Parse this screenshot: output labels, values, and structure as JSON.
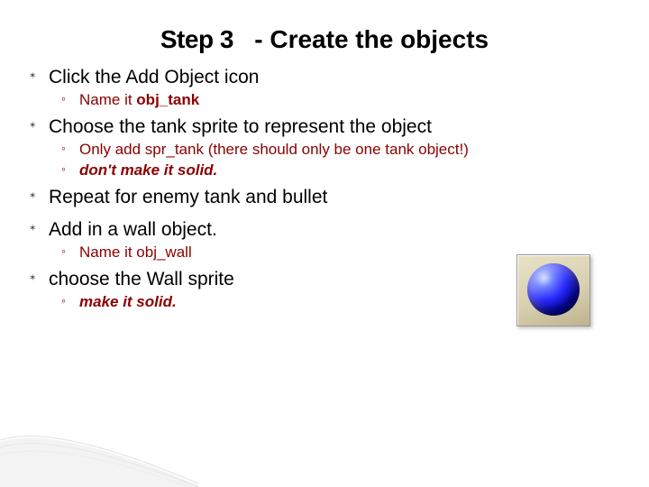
{
  "title_a": "Step 3",
  "title_b": "- Create the objects",
  "items": [
    {
      "text": "Click the Add Object icon",
      "subs": [
        {
          "pre": "Name it ",
          "bold": "obj_tank",
          "post": ""
        }
      ]
    },
    {
      "text": "Choose the tank sprite to represent the object",
      "subs": [
        {
          "pre": "Only add spr_tank (there should only be one tank object!)",
          "bold": "",
          "post": ""
        },
        {
          "pre": "",
          "boldItalic": "don't make it solid.",
          "post": ""
        }
      ]
    },
    {
      "text": "Repeat for enemy tank and bullet",
      "subs": []
    },
    {
      "text": "Add in a wall object.",
      "subs": [
        {
          "pre": " Name it obj_wall",
          "bold": "",
          "post": ""
        }
      ]
    },
    {
      "text": "choose the Wall sprite",
      "subs": [
        {
          "pre": "",
          "boldItalic": "make it solid.",
          "post": ""
        }
      ]
    }
  ],
  "icon_name": "blue-sphere-icon"
}
